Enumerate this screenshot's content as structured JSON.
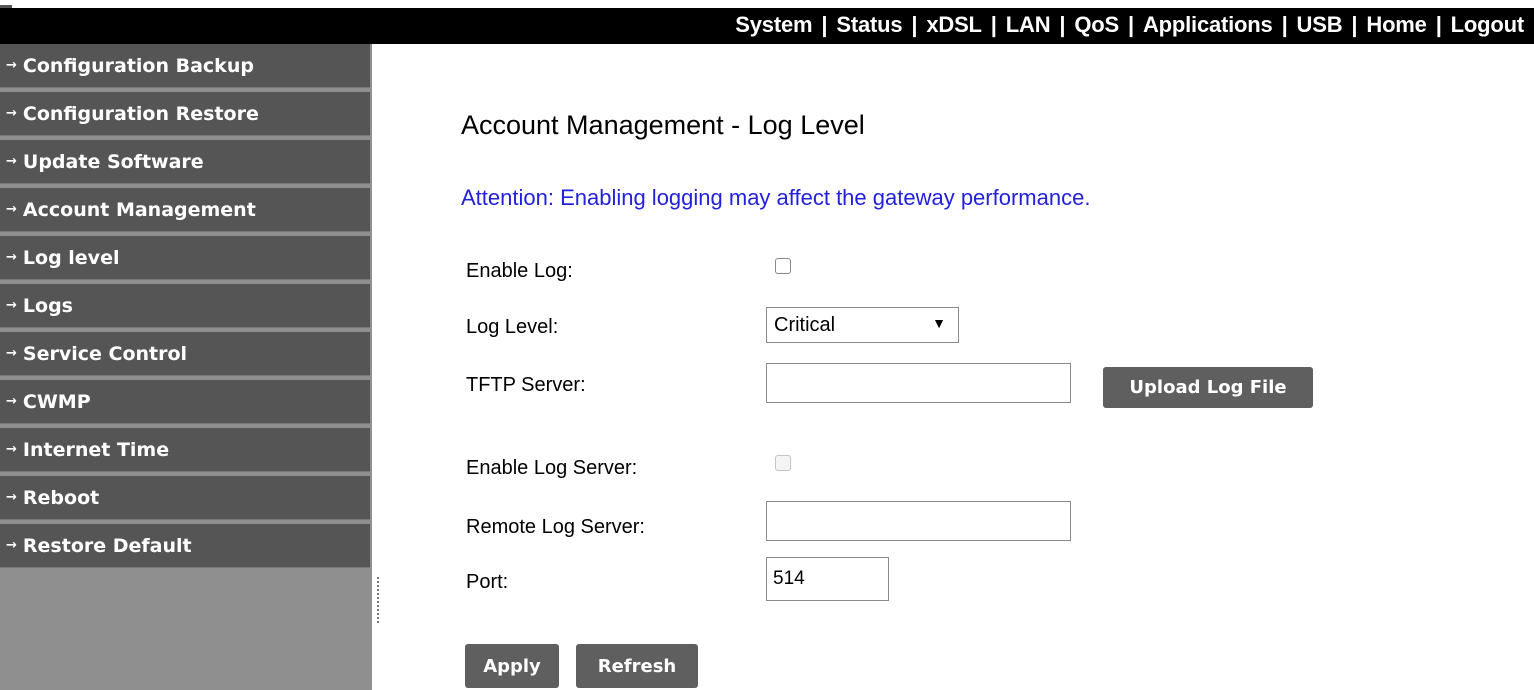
{
  "topnav": {
    "items": [
      "System",
      "Status",
      "xDSL",
      "LAN",
      "QoS",
      "Applications",
      "USB",
      "Home",
      "Logout"
    ],
    "separator": "|"
  },
  "sidebar": {
    "arrow": "→",
    "items": [
      {
        "label": "Configuration Backup"
      },
      {
        "label": "Configuration Restore"
      },
      {
        "label": "Update Software"
      },
      {
        "label": "Account Management"
      },
      {
        "label": "Log level"
      },
      {
        "label": "Logs"
      },
      {
        "label": "Service Control"
      },
      {
        "label": "CWMP"
      },
      {
        "label": "Internet Time"
      },
      {
        "label": "Reboot"
      },
      {
        "label": "Restore Default"
      }
    ]
  },
  "page": {
    "title": "Account Management - Log Level",
    "attention": "Attention: Enabling logging may affect the gateway performance."
  },
  "form": {
    "enable_log_label": "Enable Log:",
    "enable_log_checked": false,
    "log_level_label": "Log Level:",
    "log_level_value": "Critical",
    "tftp_server_label": "TFTP Server:",
    "tftp_server_value": "",
    "upload_button": "Upload Log File",
    "enable_log_server_label": "Enable Log Server:",
    "enable_log_server_checked": false,
    "remote_log_server_label": "Remote Log Server:",
    "remote_log_server_value": "",
    "port_label": "Port:",
    "port_value": "514"
  },
  "buttons": {
    "apply": "Apply",
    "refresh": "Refresh"
  },
  "colors": {
    "topbar": "#000000",
    "sidebar_item": "#555555",
    "sidebar_bg": "#8f8f8f",
    "attention_text": "#2222dd",
    "button": "#5f5f5f"
  },
  "icons": {
    "sidebar_item": "right-arrow-icon",
    "dropdown": "triangle-down-icon"
  }
}
